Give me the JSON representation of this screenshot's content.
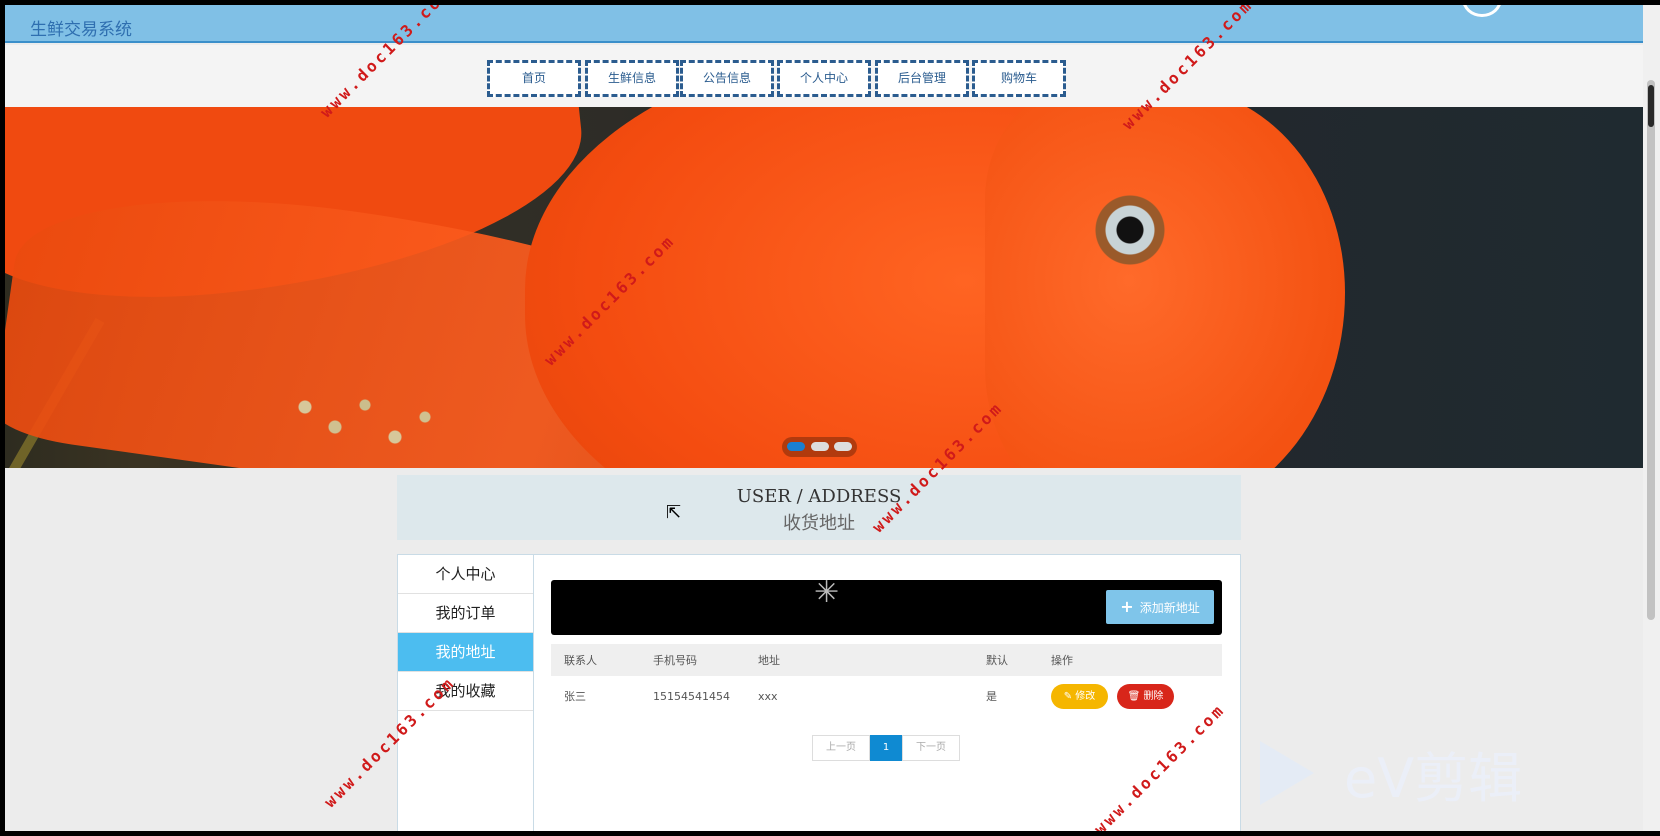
{
  "header": {
    "site_title": "生鲜交易系统"
  },
  "nav": {
    "items": [
      "首页",
      "生鲜信息",
      "公告信息",
      "个人中心",
      "后台管理",
      "购物车"
    ]
  },
  "banner": {
    "active_slide": 1,
    "slide_count": 3
  },
  "page_title": {
    "en": "USER / ADDRESS",
    "cn": "收货地址"
  },
  "sidebar": {
    "items": [
      {
        "label": "个人中心"
      },
      {
        "label": "我的订单"
      },
      {
        "label": "我的地址",
        "active": true
      },
      {
        "label": "我的收藏"
      }
    ]
  },
  "toolbar": {
    "add_label": "添加新地址"
  },
  "table": {
    "headers": [
      "联系人",
      "手机号码",
      "地址",
      "默认",
      "操作"
    ],
    "rows": [
      {
        "contact": "张三",
        "phone": "15154541454",
        "address": "xxx",
        "default": "是",
        "edit": "修改",
        "delete": "删除"
      }
    ]
  },
  "pagination": {
    "prev": "上一页",
    "current": "1",
    "next": "下一页"
  },
  "watermark": "www.doc163.com",
  "overlay_logo": "eV剪辑",
  "colors": {
    "topbar": "#80c0e6",
    "nav_border": "#2b5c8f",
    "active_side": "#4cbdf0",
    "edit": "#f5b600",
    "delete": "#d8261a",
    "page_active": "#0f8ad2"
  }
}
